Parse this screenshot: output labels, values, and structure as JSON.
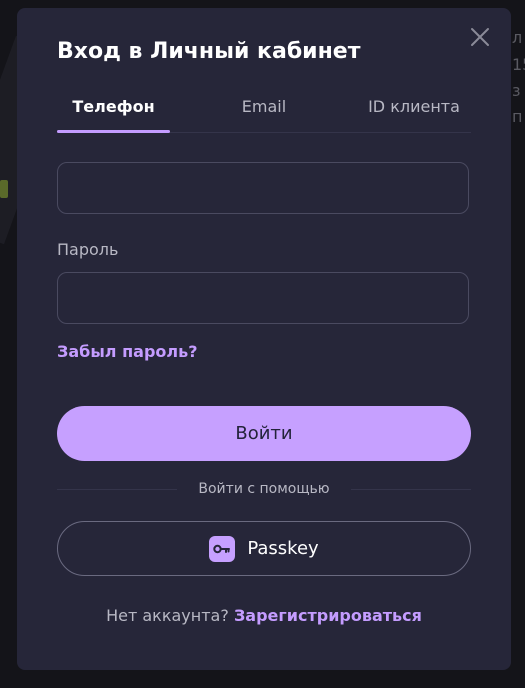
{
  "background": {
    "peek_lines": [
      "л",
      "15",
      "з",
      "п"
    ]
  },
  "modal": {
    "title": "Вход в Личный кабинет",
    "close_icon": "close-icon"
  },
  "tabs": [
    {
      "label": "Телефон",
      "active": true
    },
    {
      "label": "Email",
      "active": false
    },
    {
      "label": "ID клиента",
      "active": false
    }
  ],
  "form": {
    "phone_value": "",
    "password_label": "Пароль",
    "password_value": "",
    "forgot_label": "Забыл пароль?",
    "login_label": "Войти"
  },
  "alt_login": {
    "divider_text": "Войти с помощью",
    "passkey_label": "Passkey",
    "passkey_icon": "key-icon"
  },
  "register": {
    "prompt": "Нет аккаунта?",
    "link": "Зарегистрироваться"
  },
  "colors": {
    "accent": "#c49cff",
    "button": "#c6a0ff",
    "modal_bg": "#262639"
  }
}
